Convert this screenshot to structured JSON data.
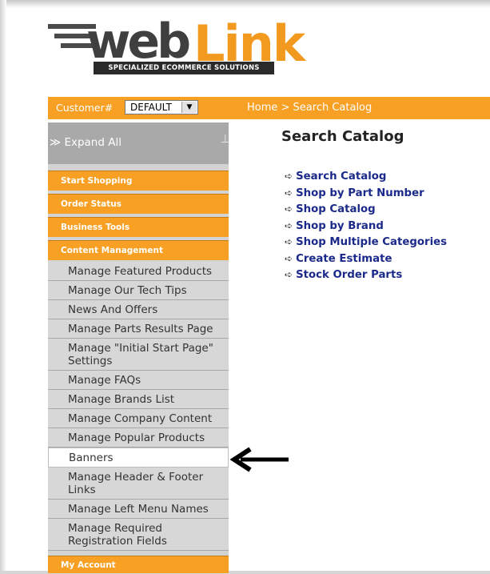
{
  "logo": {
    "text_web": "web",
    "text_link": "Link",
    "tagline": "SPECIALIZED ECOMMERCE SOLUTIONS"
  },
  "topbar": {
    "customer_label": "Customer#",
    "customer_value": "DEFAULT",
    "breadcrumb": "Home >  Search Catalog"
  },
  "sidebar": {
    "expand_label": "Expand All",
    "sections": [
      {
        "label": "Start Shopping"
      },
      {
        "label": "Order Status"
      },
      {
        "label": "Business Tools"
      },
      {
        "label": "Content Management"
      },
      {
        "label": "My Account"
      }
    ],
    "content_items": [
      {
        "label": "Manage Featured Products"
      },
      {
        "label": "Manage Our Tech Tips"
      },
      {
        "label": "News And Offers"
      },
      {
        "label": "Manage Parts Results Page"
      },
      {
        "label": "Manage \"Initial Start Page\" Settings"
      },
      {
        "label": "Manage FAQs"
      },
      {
        "label": "Manage Brands List"
      },
      {
        "label": "Manage Company Content"
      },
      {
        "label": "Manage Popular Products"
      },
      {
        "label": "Banners"
      },
      {
        "label": "Manage Header & Footer Links"
      },
      {
        "label": "Manage Left Menu Names"
      },
      {
        "label": "Manage Required Registration Fields"
      }
    ]
  },
  "main": {
    "title": "Search Catalog",
    "bullet": "➪",
    "links": [
      {
        "label": "Search Catalog"
      },
      {
        "label": "Shop by Part Number"
      },
      {
        "label": "Shop Catalog"
      },
      {
        "label": "Shop by Brand"
      },
      {
        "label": "Shop Multiple Categories"
      },
      {
        "label": "Create Estimate"
      },
      {
        "label": "Stock Order Parts"
      }
    ]
  },
  "colors": {
    "accent_orange": "#f7a024",
    "link_blue": "#1b2a8a",
    "sidebar_gray": "#d7d7d7"
  }
}
